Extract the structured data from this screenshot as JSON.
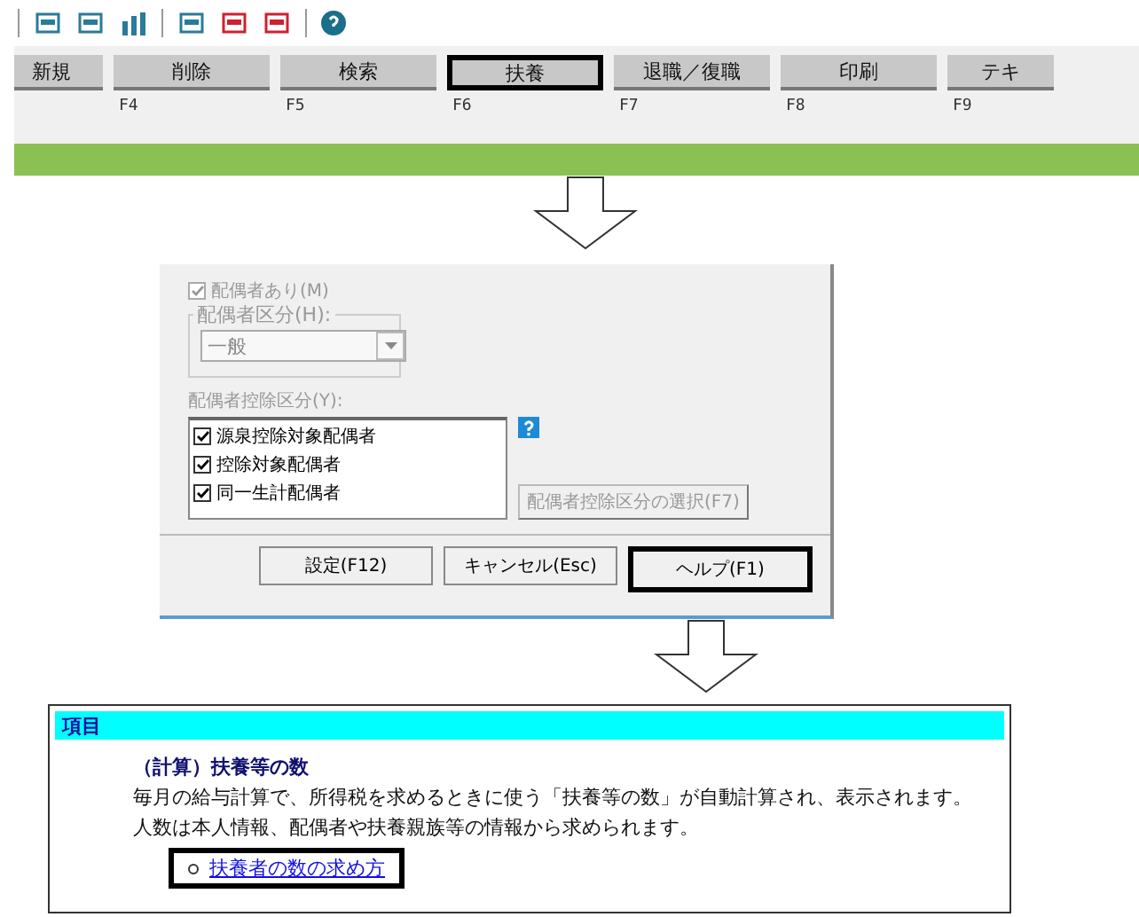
{
  "function_keys": [
    {
      "label": "新規",
      "highlighted": false
    },
    {
      "label": "削除",
      "key": "F4",
      "highlighted": false
    },
    {
      "label": "検索",
      "key": "F5",
      "highlighted": false
    },
    {
      "label": "扶養",
      "key": "F6",
      "highlighted": true
    },
    {
      "label": "退職／復職",
      "key": "F7",
      "highlighted": false
    },
    {
      "label": "印刷",
      "key": "F8",
      "highlighted": false
    },
    {
      "label": "テキ",
      "key": "F9",
      "highlighted": false
    }
  ],
  "dialog": {
    "spouse_checkbox": {
      "label": "配偶者あり(M)",
      "checked": true,
      "disabled": true
    },
    "spouse_type": {
      "label": "配偶者区分(H):",
      "value": "一般"
    },
    "deduction": {
      "label": "配偶者控除区分(Y):",
      "items": [
        {
          "label": "源泉控除対象配偶者",
          "checked": true
        },
        {
          "label": "控除対象配偶者",
          "checked": true
        },
        {
          "label": "同一生計配偶者",
          "checked": true
        }
      ]
    },
    "select_button": {
      "label": "配偶者控除区分の選択(F7)",
      "disabled": true
    },
    "buttons": [
      {
        "label": "設定(F12)",
        "highlighted": false
      },
      {
        "label": "キャンセル(Esc)",
        "highlighted": false
      },
      {
        "label": "ヘルプ(F1)",
        "highlighted": true
      }
    ]
  },
  "help": {
    "header": "項目",
    "title": "（計算）扶養等の数",
    "lines": [
      "毎月の給与計算で、所得税を求めるときに使う「扶養等の数」が自動計算され、表示されます。",
      "人数は本人情報、配偶者や扶養親族等の情報から求められます。"
    ],
    "link": {
      "label": "扶養者の数の求め方",
      "highlighted": true
    }
  }
}
